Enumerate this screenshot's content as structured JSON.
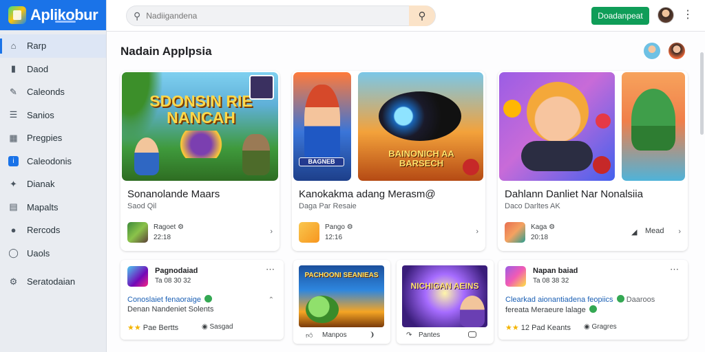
{
  "app": {
    "brand": "Aplikobur"
  },
  "sidebar": {
    "items": [
      {
        "label": "Rarp",
        "icon": "home-icon",
        "active": true
      },
      {
        "label": "Daod",
        "icon": "bookmark-icon",
        "active": false
      },
      {
        "label": "Caleonds",
        "icon": "edit-icon",
        "active": false
      },
      {
        "label": "Sanios",
        "icon": "list-icon",
        "active": false
      },
      {
        "label": "Pregpies",
        "icon": "grid-icon",
        "active": false
      },
      {
        "label": "Caleodonis",
        "icon": "info-icon",
        "active": false
      },
      {
        "label": "Dianak",
        "icon": "puzzle-icon",
        "active": false
      },
      {
        "label": "Mapalts",
        "icon": "chart-icon",
        "active": false
      },
      {
        "label": "Rercods",
        "icon": "circle-icon",
        "active": false
      },
      {
        "label": "Uaols",
        "icon": "clock-icon",
        "active": false
      }
    ],
    "footer_item": {
      "label": "Seratodaian",
      "icon": "settings-icon"
    }
  },
  "topbar": {
    "search_placeholder": "Nadiigandena",
    "cta_label": "Doadanpeat"
  },
  "main": {
    "section_title": "Nadain Applpsia",
    "featured": [
      {
        "title": "Sonanolande Maars",
        "subtitle": "Saod Qil",
        "art_text": "SDONSIN RIE NANCAH",
        "dev_name": "Ragoet ⚙",
        "dev_size": "22:18"
      },
      {
        "title": "Kanokakma adang Merasm@",
        "subtitle": "Daga Par Resaie",
        "art_text_small": "BAGNEB",
        "art_text": "BAINONICH AA BARSECH",
        "dev_name": "Pango ⚙",
        "dev_size": "12:16"
      },
      {
        "title": "Dahlann Danliet Nar Nonalsiia",
        "subtitle": "Daco Darltes AK",
        "dev_name": "Kaga ⚙",
        "dev_size": "20:18",
        "action_label": "Mead"
      }
    ],
    "lower": [
      {
        "name": "Pagnodaiad",
        "meta": "Ta 08 30 32",
        "desc": "Conoslaiet fenaoraige",
        "desc2": "Denan Nandeniet Solents",
        "rating_text": "Pae Bertts",
        "tag": "Sasgad"
      },
      {
        "art_text": "PACHOONI SEANIEAS",
        "action_label": "Manpos"
      },
      {
        "art_text": "NICHIGAN AEINS",
        "action_label": "Pantes"
      },
      {
        "name": "Napan baiad",
        "meta": "Ta 08 38 32",
        "desc": "Clearkad aionantiadena feopiics",
        "desc_extra": "Daaroos",
        "desc2": "fereata Meraeure lalage",
        "rating_text": "12 Pad Keants",
        "tag": "Gragres"
      }
    ]
  },
  "colors": {
    "brand": "#1a73e8",
    "cta": "#0f9d58",
    "star": "#f4b400"
  }
}
